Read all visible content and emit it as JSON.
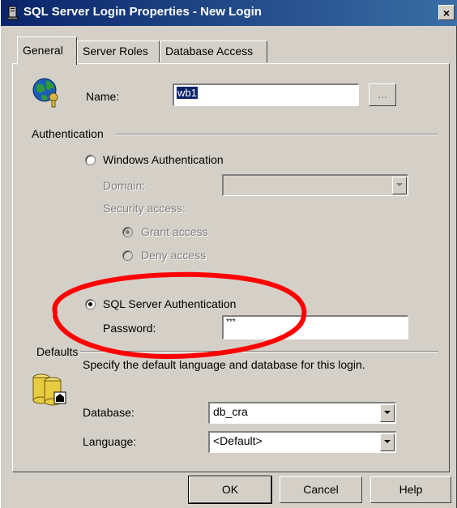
{
  "window": {
    "title": "SQL Server Login Properties - New Login",
    "close_label": "×"
  },
  "tabs": [
    {
      "label": "General",
      "active": true
    },
    {
      "label": "Server Roles",
      "active": false
    },
    {
      "label": "Database Access",
      "active": false
    }
  ],
  "general": {
    "name_label": "Name:",
    "name_value": "wb1",
    "browse_label": "...",
    "auth_group_label": "Authentication",
    "windows_auth_label": "Windows Authentication",
    "domain_label": "Domain:",
    "domain_value": "",
    "security_access_label": "Security access:",
    "grant_access_label": "Grant access",
    "deny_access_label": "Deny access",
    "sql_auth_label": "SQL Server Authentication",
    "password_label": "Password:",
    "password_value": "***",
    "defaults_group_label": "Defaults",
    "defaults_description": "Specify the default language and database for this login.",
    "database_label": "Database:",
    "database_value": "db_cra",
    "language_label": "Language:",
    "language_value": "<Default>"
  },
  "buttons": {
    "ok": "OK",
    "cancel": "Cancel",
    "help": "Help"
  },
  "colors": {
    "dialog_bg": "#d4d0c8",
    "titlebar": "#0a246a",
    "annotation": "#ff0000"
  }
}
